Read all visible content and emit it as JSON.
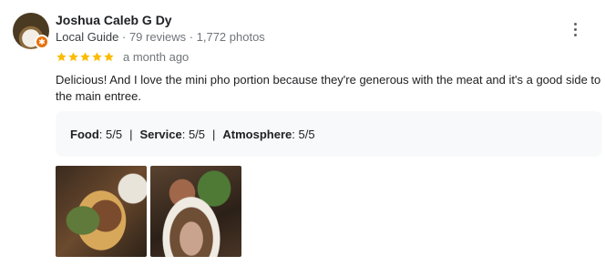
{
  "reviewer": {
    "name": "Joshua Caleb G Dy",
    "level": "Local Guide",
    "stats": " · 79 reviews · 1,772 photos"
  },
  "review": {
    "rating": 5,
    "max_rating": 5,
    "time": "a month ago",
    "text": "Delicious! And I love the mini pho portion because they're generous with the meat and it's a good side to the main entree.",
    "ratings": {
      "food_label": "Food",
      "food_value": ": 5/5",
      "service_label": "Service",
      "service_value": ": 5/5",
      "atmosphere_label": "Atmosphere",
      "atmosphere_value": ": 5/5",
      "separator": "|"
    }
  },
  "colors": {
    "star": "#fbbc04",
    "badge": "#e8710a"
  },
  "icons": {
    "more": "more-vert-icon",
    "star": "star-icon",
    "badge": "local-guide-badge-icon"
  }
}
